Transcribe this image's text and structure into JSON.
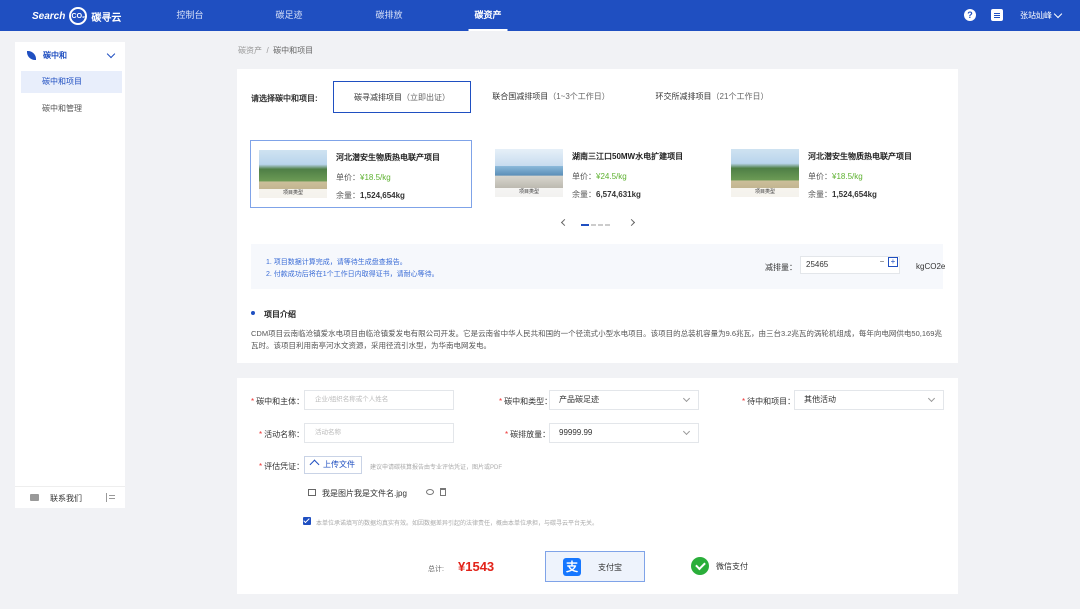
{
  "header": {
    "logo_text": "Search",
    "logo_badge": "CO₂",
    "logo_cn": "碳寻云",
    "nav": [
      "控制台",
      "碳足迹",
      "碳排放",
      "碳资产"
    ],
    "user_name": "张站灿峰"
  },
  "sidebar": {
    "group_label": "碳中和",
    "items": [
      "碳中和项目",
      "碳中和管理"
    ],
    "contact_label": "联系我们"
  },
  "breadcrumb": {
    "parent": "碳资产",
    "separator": "/",
    "current": "碳中和项目"
  },
  "selection": {
    "label": "请选择碳中和项目:",
    "tabs": [
      {
        "name": "碳寻减排项目",
        "note": "（立即出证）"
      },
      {
        "name": "联合国减排项目",
        "note": "（1~3个工作日）"
      },
      {
        "name": "环交所减排项目",
        "note": "（21个工作日）"
      }
    ]
  },
  "projects": [
    {
      "name": "河北潜安生物质热电联产项目",
      "price_label": "单价：",
      "price": "¥18.5/kg",
      "stock_label": "余量：",
      "stock": "1,524,654kg",
      "tag": "项目类型"
    },
    {
      "name": "湖南三江口50MW水电扩建项目",
      "price_label": "单价：",
      "price": "¥24.5/kg",
      "stock_label": "余量：",
      "stock": "6,574,631kg",
      "tag": "项目类型"
    },
    {
      "name": "河北潜安生物质热电联产项目",
      "price_label": "单价：",
      "price": "¥18.5/kg",
      "stock_label": "余量：",
      "stock": "1,524,654kg",
      "tag": "项目类型"
    }
  ],
  "notice": {
    "lines": [
      "1. 项目数据计算完成，请等待生成盘查报告。",
      "2. 付款成功后将在1个工作日内取得证书，请耐心等待。"
    ],
    "qty_label": "减排量：",
    "qty_value": "25465",
    "qty_minus": "−",
    "qty_plus": "+",
    "qty_unit": "kgCO2e"
  },
  "intro": {
    "title": "项目介绍",
    "text": "CDM项目云南临沧镇爱水电项目由临沧镇爱发电有限公司开发。它是云南省中华人民共和国的一个径流式小型水电项目。该项目的总装机容量为9.6兆瓦，由三台3.2兆瓦的涡轮机组成，每年向电网供电50,169兆瓦时。该项目利用南亭河水文资源，采用径流引水型，为华南电网发电。"
  },
  "form": {
    "subject_label": "碳中和主体：",
    "subject_placeholder": "企业/组织名称或个人姓名",
    "type_label": "碳中和类型：",
    "type_value": "产品碳足迹",
    "target_label": "待中和项目：",
    "target_value": "其他活动",
    "activity_label": "活动名称：",
    "activity_placeholder": "活动名称",
    "emission_label": "碳排放量：",
    "emission_value": "99999.99",
    "evidence_label": "评估凭证：",
    "upload_label": "上传文件",
    "upload_hint": "建议申请碳核算报告由专业评估凭证，图片或PDF",
    "file_name": "我是图片我是文件名.jpg",
    "agree_text": "本单位承诺填写的数据均真实有效。如因数据差异引起的法律责任，概由本单位承担，与碳寻云平台无关。"
  },
  "payment": {
    "total_label": "总计:",
    "total_value": "¥1543",
    "alipay_label": "支付宝",
    "alipay_glyph": "支",
    "wechat_label": "微信支付"
  },
  "colors": {
    "brand": "#1f4fc1",
    "price": "#5db12f",
    "total": "#e2231a"
  }
}
